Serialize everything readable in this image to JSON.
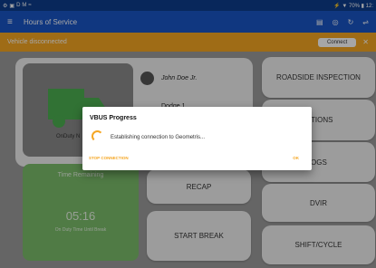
{
  "status_bar": {
    "left_icons": [
      "⚙",
      "▣",
      "D",
      "M",
      "≈"
    ],
    "right_text": "⚡ ▼ 70% ▮ 12:"
  },
  "app_bar": {
    "menu_icon": "≡",
    "title": "Hours of Service",
    "action_icons": [
      "▤",
      "◎",
      "↻",
      "⇌"
    ]
  },
  "banner": {
    "message": "Vehicle disconnected",
    "connect_label": "Connect",
    "close_icon": "✕"
  },
  "driver": {
    "name": "John Doe Jr.",
    "vehicle": "Dodge 1",
    "status": "OnDuty N"
  },
  "time_card": {
    "title": "Time Remaining",
    "value": "05:16",
    "subtitle": "On Duty Time Until Break"
  },
  "buttons": {
    "roadside": "ROADSIDE INSPECTION",
    "tions": "TIONS",
    "logs": "OGS",
    "recap": "RECAP",
    "dvir": "DVIR",
    "start_break": "START BREAK",
    "shift_cycle": "SHIFT/CYCLE"
  },
  "dialog": {
    "title": "VBUS Progress",
    "message": "Establishing connection to Geometris...",
    "stop_label": "STOP CONNECTION",
    "ok_label": "OK"
  },
  "colors": {
    "status_bar": "#0d3c8c",
    "app_bar": "#1a55c5",
    "banner": "#f5a623",
    "accent": "#f5a623",
    "time_card": "#7cbd6b"
  }
}
